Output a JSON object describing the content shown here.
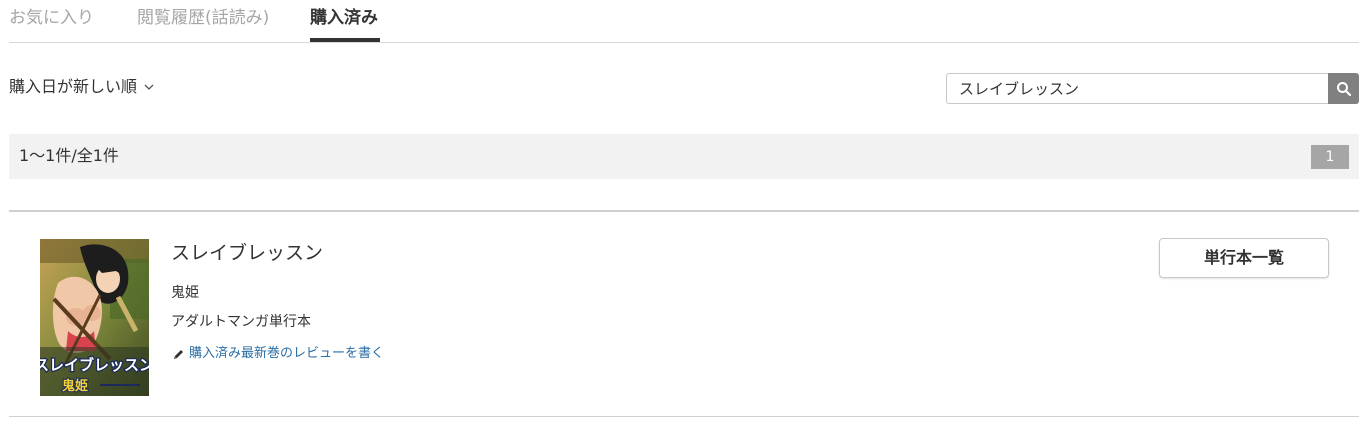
{
  "tabs": [
    {
      "label": "お気に入り",
      "active": false
    },
    {
      "label": "閲覧履歴(話読み)",
      "active": false
    },
    {
      "label": "購入済み",
      "active": true
    }
  ],
  "sort": {
    "label": "購入日が新しい順"
  },
  "search": {
    "value": "スレイブレッスン"
  },
  "results": {
    "count_label": "1〜1件/全1件",
    "pages": [
      "1"
    ]
  },
  "items": [
    {
      "title": "スレイブレッスン",
      "author": "鬼姫",
      "category": "アダルトマンガ単行本",
      "review_link": "購入済み最新巻のレビューを書く",
      "volumes_button": "単行本一覧",
      "cover_text": {
        "title": "スレイブレッスン",
        "author": "鬼姫"
      }
    }
  ],
  "colors": {
    "accent_link": "#2a6ea5",
    "search_button_bg": "#808080",
    "results_bar_bg": "#f2f2f2",
    "page_badge_bg": "#a6a6a6"
  },
  "icons": {
    "sort": "chevron-down-icon",
    "search": "search-icon",
    "review": "pencil-icon"
  }
}
